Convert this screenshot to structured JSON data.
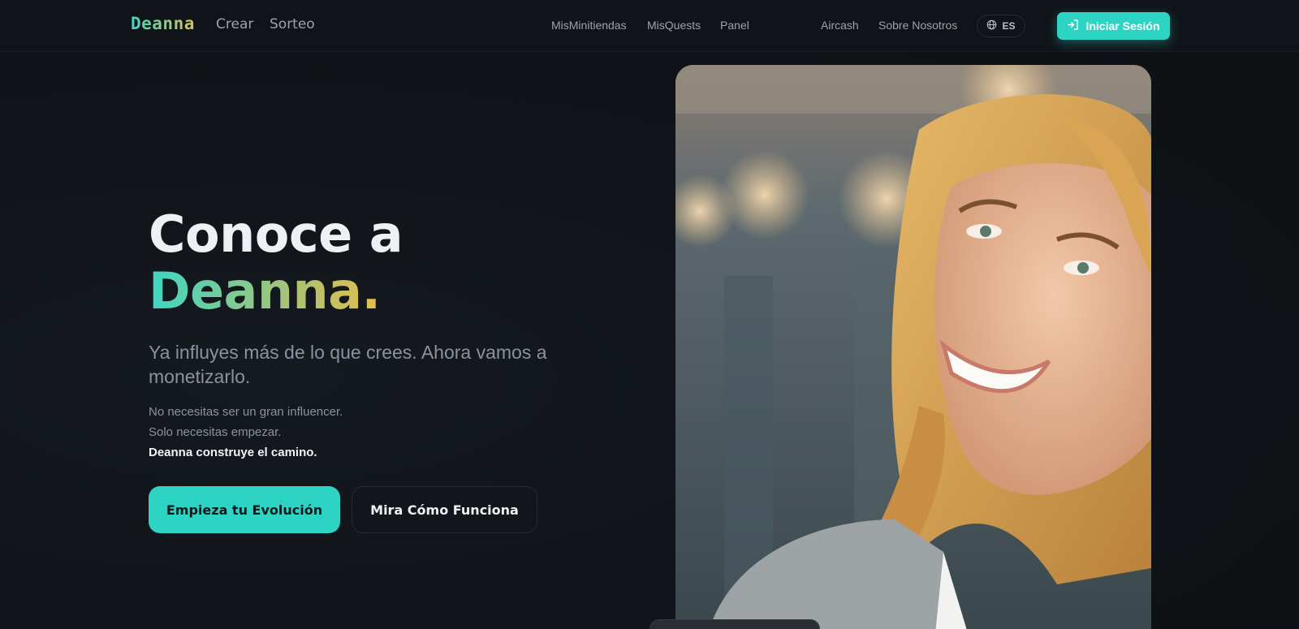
{
  "nav": {
    "logo": "Deanna",
    "left_links": [
      "Crear",
      "Sorteo"
    ],
    "center_links": [
      "MisMinitiendas",
      "MisQuests",
      "Panel"
    ],
    "right_links": [
      "Aircash",
      "Sobre Nosotros"
    ],
    "language": "ES",
    "login_label": "Iniciar Sesión"
  },
  "hero": {
    "title_line1": "Conoce a",
    "title_line2": "Deanna.",
    "subtitle": "Ya influyes más de lo que crees. Ahora vamos a monetizarlo.",
    "line1": "No necesitas ser un gran influencer.",
    "line2": "Solo necesitas empezar.",
    "line3": "Deanna construye el camino.",
    "cta_primary": "Empieza tu Evolución",
    "cta_secondary": "Mira Cómo Funciona"
  },
  "colors": {
    "accent": "#2dd4c4",
    "gold": "#e2c14a",
    "background": "#101318"
  },
  "icons": {
    "language": "globe-icon",
    "login": "login-arrow-icon"
  }
}
